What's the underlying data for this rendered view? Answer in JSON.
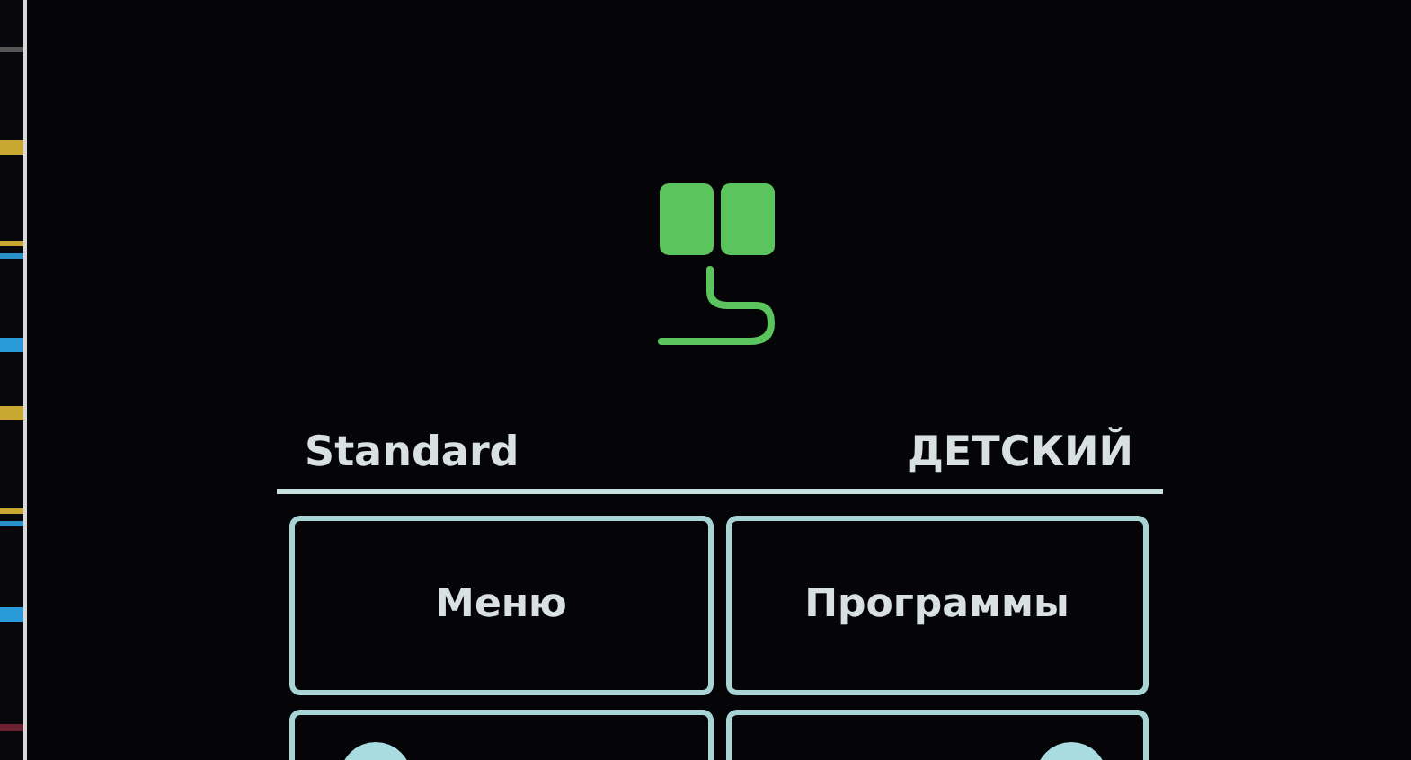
{
  "mode_labels": [
    "Standard",
    "ДЕТСКИЙ"
  ],
  "buttons": [
    {
      "label": "Меню"
    },
    {
      "label": "Программы"
    }
  ]
}
